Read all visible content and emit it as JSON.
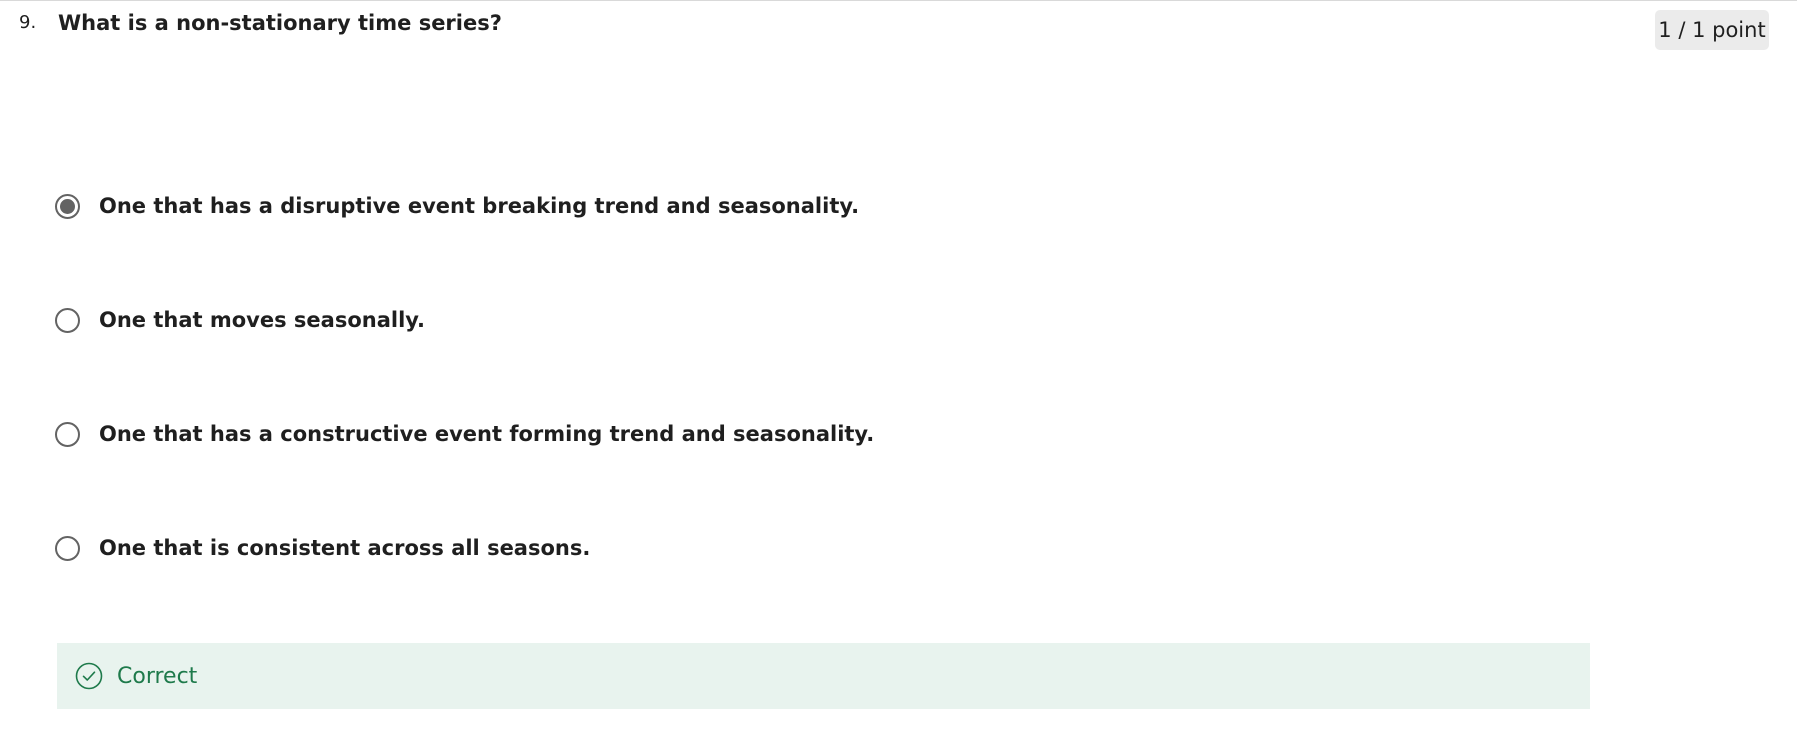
{
  "question": {
    "number": "9.",
    "title": "What is a non-stationary time series?",
    "score": "1 / 1 point"
  },
  "options": [
    {
      "label": "One that has a disruptive event breaking trend and seasonality.",
      "selected": true
    },
    {
      "label": "One that moves seasonally.",
      "selected": false
    },
    {
      "label": "One that has a constructive event forming trend and seasonality.",
      "selected": false
    },
    {
      "label": "One that is consistent across all seasons.",
      "selected": false
    }
  ],
  "feedback": {
    "status": "Correct",
    "icon": "check-circle-icon",
    "color": "#1e7a4b",
    "background": "#e8f3ee"
  }
}
